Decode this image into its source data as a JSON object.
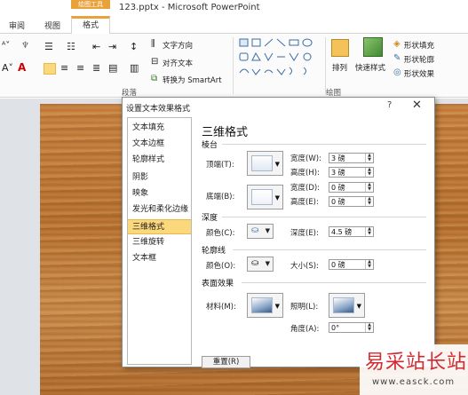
{
  "window": {
    "title": "123.pptx - Microsoft PowerPoint",
    "context_tab_group": "绘图工具"
  },
  "ribbon_tabs": [
    {
      "label": "审阅"
    },
    {
      "label": "视图"
    },
    {
      "label": "格式",
      "active": true
    }
  ],
  "ribbon": {
    "text_direction": "文字方向",
    "align_text": "对齐文本",
    "convert_smartart": "转换为 SmartArt",
    "arrange": "排列",
    "quick_styles": "快速样式",
    "shape_fill": "形状填充",
    "shape_outline": "形状轮廓",
    "shape_effects": "形状效果",
    "paragraph_group": "段落",
    "drawing_group": "绘图"
  },
  "dialog": {
    "title": "设置文本效果格式",
    "help": "?",
    "close": "✕",
    "nav": [
      {
        "label": "文本填充"
      },
      {
        "label": "文本边框"
      },
      {
        "label": "轮廓样式"
      },
      {
        "label": "阴影"
      },
      {
        "label": "映象"
      },
      {
        "label": "发光和柔化边缘"
      },
      {
        "label": "三维格式",
        "selected": true
      },
      {
        "label": "三维旋转"
      },
      {
        "label": "文本框"
      }
    ],
    "panel_title": "三维格式",
    "bevel": {
      "section": "棱台",
      "top_label": "顶端(T):",
      "bottom_label": "底端(B):",
      "top_width_label": "宽度(W):",
      "top_width": "3 磅",
      "top_height_label": "高度(H):",
      "top_height": "3 磅",
      "bottom_width_label": "宽度(D):",
      "bottom_width": "0 磅",
      "bottom_height_label": "高度(E):",
      "bottom_height": "0 磅"
    },
    "depth": {
      "section": "深度",
      "color_label": "颜色(C):",
      "depth_label": "深度(E):",
      "depth_value": "4.5 磅"
    },
    "contour": {
      "section": "轮廓线",
      "color_label": "颜色(O):",
      "size_label": "大小(S):",
      "size_value": "0 磅"
    },
    "surface": {
      "section": "表面效果",
      "material_label": "材料(M):",
      "lighting_label": "照明(L):",
      "angle_label": "角度(A):",
      "angle_value": "0°"
    },
    "reset_label": "重置(R)"
  },
  "watermark": {
    "main": "易采站长站",
    "sub": "www.easck.com"
  },
  "colors": {
    "accent": "#e9a13a",
    "selected_nav": "#fcd87c",
    "watermark": "#d6292f"
  }
}
